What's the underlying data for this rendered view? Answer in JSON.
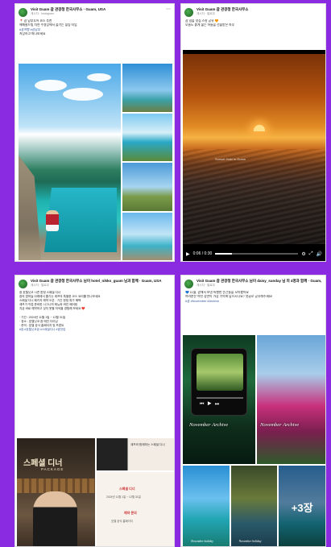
{
  "colors": {
    "background": "#8a2be2",
    "link": "#385898"
  },
  "posts": [
    {
      "page_name": "Visit Guam 괌 관광청 한국사무소 · Guam, USA",
      "meta": "게시자 · Instagram",
      "caption": [
        "📍 괌 남부투어 코스 추천",
        "에메랄드빛 자연 수영장에서 즐기는 힐링 타임",
        "#괌여행 #괌남부",
        "저장하고 떠나보세요"
      ]
    },
    {
      "page_name": "Visit Guam 괌 관광청 한국사무소",
      "meta": "게시자 · 팔로우",
      "caption": [
        "괌 일몰 맛집 스팟 공유 🧡",
        "오늘도 붉게 물든 하늘을 선물받은 하루"
      ],
      "video": {
        "watermark": "Sunset Hobi in Guam",
        "time": "0:06 / 0:30",
        "progress": 0.2
      }
    },
    {
      "page_name": "Visit Guam 괌 관광청 한국사무소 님이 hotel_nikko_guam 님과 함께 · Guam, USA",
      "meta": "게시자 · 팔로우",
      "caption": [
        "괌 호텔닛코 시즌 한정 스페셜 디너",
        "괌의 밤하늘 아래에서 즐기는 셰프의 특별한 코스 요리를 만나보세요",
        "스페셜 디너 패키지 예약 오픈 · 기간 한정 특가 혜택",
        "셰프가 직접 준비한 시그니처 메뉴와 와인 페어링",
        "지금 바로 예약하고 잊지 못할 저녁을 경험해 보세요 ❤️",
        "",
        "· 기간 : 2024년 11월 1일 ~ 12월 31일",
        "· 장소 : 호텔닛코 괌 메인 다이닝",
        "· 문의 : 호텔 공식 홈페이지 및 프론트",
        "#괌 #호텔닛코괌 #스페셜디너 #괌맛집"
      ],
      "poster_main_title": "스페셜 디너",
      "poster_main_sub": "PACKAGE",
      "poster_side": "셰프와 함께하는 스페셜 디너",
      "menu_1": "스페셜 디너",
      "menu_1_desc": "2024년 11월 1일 ~ 12월 31일",
      "menu_2": "예약 문의",
      "menu_2_desc": "호텔 공식 홈페이지"
    },
    {
      "page_name": "Visit Guam 괌 관광청 한국사무소 님이 daisy_sunday 님 외 4명과 함께 · Guam, USA",
      "meta": "게시자 · 팔로우",
      "caption": [
        "💙 11월, 괌에서 보낸 특별한 순간들을 모아봤어요",
        "여러분은 어떤 장면이 가장 기억에 남으시나요? 댓글로 공유해주세요!",
        "#괌 #November #Archive"
      ],
      "tiles": {
        "archive_1": "November Archive",
        "archive_2": "November Archive",
        "holiday": "November holiday",
        "more_count": "+3장"
      }
    }
  ]
}
